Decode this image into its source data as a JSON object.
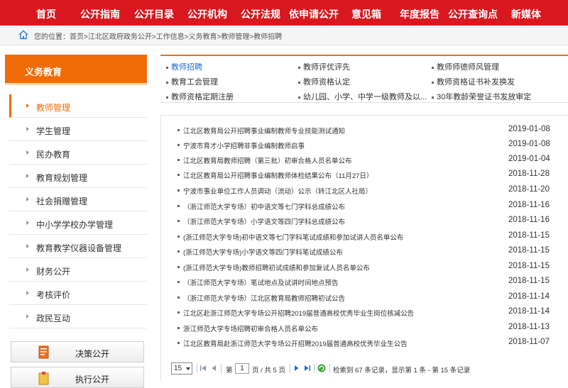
{
  "nav": {
    "items": [
      "首页",
      "公开指南",
      "公开目录",
      "公开机构",
      "公开法规",
      "依申请公开",
      "意见箱",
      "年度报告",
      "公开查询点",
      "新媒体"
    ]
  },
  "breadcrumb": {
    "text": "您的位置：首页>江北区政府政务公开>工作信息>义务教育>教师管理>教师招聘"
  },
  "sidebar": {
    "title": "义务教育",
    "items": [
      "教师管理",
      "学生管理",
      "民办教育",
      "教育规划管理",
      "社会捐赠管理",
      "中小学学校办学管理",
      "教育教学仪器设备管理",
      "财务公开",
      "考核评价",
      "政民互动"
    ],
    "active_index": 0,
    "buttons": [
      "决策公开",
      "执行公开"
    ]
  },
  "subcategories": [
    "教师招聘",
    "教师评优评先",
    "教师师德师风管理",
    "教育工会管理",
    "教师资格认定",
    "教师资格证书补发换发",
    "教师资格定期注册",
    "幼儿园、小学、中学一级教师及以...",
    "30年教龄荣誉证书发放审定"
  ],
  "current_subcategory": "教师招聘",
  "articles": [
    {
      "title": "江北区教育局公开招聘事业编制教师专业技能测试通知",
      "date": "2019-01-08"
    },
    {
      "title": "宁波市育才小学招聘非事业编制教师启事",
      "date": "2019-01-08"
    },
    {
      "title": "江北区教育局教师招聘（第三批）初审合格人员名单公布",
      "date": "2019-01-04"
    },
    {
      "title": "江北区教育局公开招聘事业编制教师体检结果公布（11月27日）",
      "date": "2018-11-28"
    },
    {
      "title": "宁波市事业单位工作人员调动（流动）公示（转江北区人社局）",
      "date": "2018-11-20"
    },
    {
      "title": "（浙江师范大学专场）初中语文等七门学科总成绩公布",
      "date": "2018-11-16"
    },
    {
      "title": "（浙江师范大学专场）小学语文等四门学科总成绩公布",
      "date": "2018-11-16"
    },
    {
      "title": "(浙江师范大学专场)初中语文等七门学科笔试成绩和参加试讲人员名单公布",
      "date": "2018-11-15"
    },
    {
      "title": "(浙江师范大学专场)小学语文等四门学科笔试成绩公布",
      "date": "2018-11-15"
    },
    {
      "title": "(浙江师范大学专场)教师招聘初试成绩和参加复试人员名单公布",
      "date": "2018-11-15"
    },
    {
      "title": "（浙江师范大学专场）笔试地点及试讲时间地点预告",
      "date": "2018-11-15"
    },
    {
      "title": "（浙江师范大学专场）江北区教育局教师招聘初试公告",
      "date": "2018-11-14"
    },
    {
      "title": "江北区赴浙江师范大学专场公开招聘2019届普通高校优秀毕业生岗位核减公告",
      "date": "2018-11-14"
    },
    {
      "title": "浙江师范大学专场招聘初审合格人员名单公布",
      "date": "2018-11-13"
    },
    {
      "title": "江北区教育局赴浙江师范大学专场公开招聘2019届普通高校优秀毕业生公告",
      "date": "2018-11-07"
    }
  ],
  "pager": {
    "page_size": "15",
    "page_label_prefix": "第",
    "current_page": "1",
    "page_label_suffix": "页 / 共 5 页",
    "summary": "检索到 67 条记录，显示第 1 条 - 第 15 条记录"
  },
  "colors": {
    "nav_red": "#d9171e",
    "accent_orange": "#ef6c07",
    "link_blue": "#1c6ed4"
  }
}
